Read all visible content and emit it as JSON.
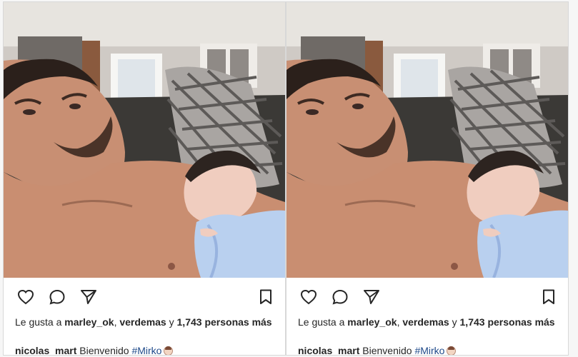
{
  "posts": [
    {
      "likes_prefix": "Le gusta a",
      "liked_by_1": "marley_ok",
      "liked_by_2": "verdemas",
      "likes_joiner": "y",
      "likes_count": "1,743 personas más",
      "username": "nicolas_mart",
      "caption_text": "Bienvenido",
      "hashtag": "#Mirko",
      "emoji_name": "baby-emoji"
    },
    {
      "likes_prefix": "Le gusta a",
      "liked_by_1": "marley_ok",
      "liked_by_2": "verdemas",
      "likes_joiner": "y",
      "likes_count": "1,743 personas más",
      "username": "nicolas_mart",
      "caption_text": "Bienvenido",
      "hashtag": "#Mirko",
      "emoji_name": "baby-emoji"
    }
  ],
  "icons": [
    "heart-icon",
    "comment-icon",
    "share-icon",
    "bookmark-icon"
  ],
  "colors": {
    "text": "#262626",
    "hashtag": "#1f4a8a",
    "border": "#d8d8d8"
  }
}
